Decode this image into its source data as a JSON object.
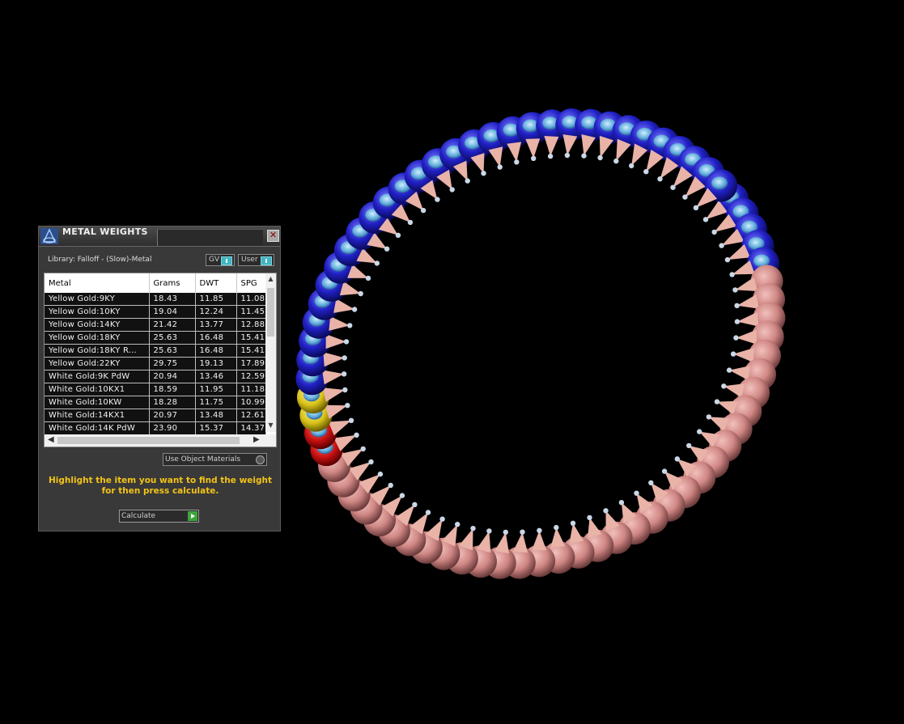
{
  "panel": {
    "title": "METAL WEIGHTS",
    "close_glyph": "✕",
    "library_label": "Library: Falloff - (Slow)-Metal",
    "gv_label": "GV",
    "user_label": "User",
    "use_object_materials_label": "Use Object Materials",
    "hint": "Highlight the item you want to find the weight for then press calculate.",
    "calculate_label": "Calculate"
  },
  "table": {
    "headers": [
      "Metal",
      "Grams",
      "DWT",
      "SPG"
    ],
    "rows": [
      [
        "Yellow Gold:9KY",
        "18.43",
        "11.85",
        "11.08"
      ],
      [
        "Yellow Gold:10KY",
        "19.04",
        "12.24",
        "11.45"
      ],
      [
        "Yellow Gold:14KY",
        "21.42",
        "13.77",
        "12.88"
      ],
      [
        "Yellow Gold:18KY",
        "25.63",
        "16.48",
        "15.41"
      ],
      [
        "Yellow Gold:18KY R...",
        "25.63",
        "16.48",
        "15.41"
      ],
      [
        "Yellow Gold:22KY",
        "29.75",
        "19.13",
        "17.89"
      ],
      [
        "White Gold:9K PdW",
        "20.94",
        "13.46",
        "12.59"
      ],
      [
        "White Gold:10KX1",
        "18.59",
        "11.95",
        "11.18"
      ],
      [
        "White Gold:10KW",
        "18.28",
        "11.75",
        "10.99"
      ],
      [
        "White Gold:14KX1",
        "20.97",
        "13.48",
        "12.61"
      ],
      [
        "White Gold:14K PdW",
        "23.90",
        "15.37",
        "14.37"
      ]
    ]
  },
  "icons": {
    "logo": "app-logo-icon",
    "close": "close-icon",
    "toggle": "toggle-switch-icon",
    "play": "play-icon"
  },
  "colors": {
    "background": "#000000",
    "panel": "#393939",
    "hint_text": "#f2c318",
    "bead_blue": "#2323c8",
    "bead_pink": "#d88a8a",
    "bead_yellow": "#e6d21e",
    "bead_red": "#d01818"
  },
  "scene": {
    "blue_bead_count": 31,
    "pink_bead_count": 42
  }
}
